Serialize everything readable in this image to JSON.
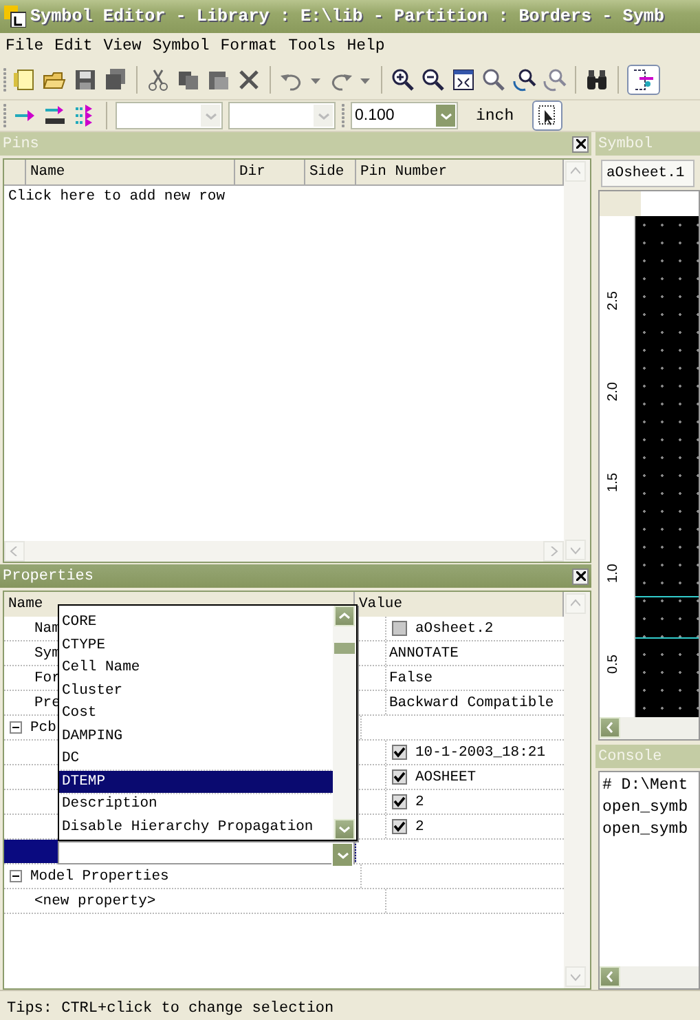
{
  "window": {
    "title": "Symbol Editor - Library : E:\\lib - Partition : Borders - Symb"
  },
  "menu": [
    "File",
    "Edit",
    "View",
    "Symbol",
    "Format",
    "Tools",
    "Help"
  ],
  "toolbar": {
    "pin_tool_pressed": true,
    "snap_value": "0.100",
    "unit": "inch",
    "select_tool_pressed": true
  },
  "pins": {
    "title": "Pins",
    "active": false,
    "columns": [
      "Name",
      "Dir",
      "Side",
      "Pin Number"
    ],
    "add_row_hint": "Click here to add new row"
  },
  "properties": {
    "title": "Properties",
    "active": true,
    "columns": [
      "Name",
      "Value"
    ],
    "rows": [
      {
        "kind": "prop",
        "name": "Nam",
        "value": "aOsheet.2",
        "checked": false
      },
      {
        "kind": "prop",
        "name": "Sym",
        "value": "ANNOTATE"
      },
      {
        "kind": "prop",
        "name": "For",
        "value": "False"
      },
      {
        "kind": "prop",
        "name": "Pre",
        "value": "Backward Compatible"
      },
      {
        "kind": "group",
        "name": "Pcb",
        "expanded": true
      },
      {
        "kind": "prop",
        "name": "",
        "value": "10-1-2003_18:21",
        "checked": true
      },
      {
        "kind": "prop",
        "name": "",
        "value": "AOSHEET",
        "checked": true
      },
      {
        "kind": "prop",
        "name": "",
        "value": "2",
        "checked": true
      },
      {
        "kind": "prop",
        "name": "",
        "value": "2",
        "checked": true
      },
      {
        "kind": "editing",
        "name": "",
        "value": ""
      },
      {
        "kind": "group",
        "name": "Model Properties",
        "expanded": true
      },
      {
        "kind": "new",
        "name": "<new property>"
      }
    ],
    "dropdown": [
      {
        "label": "CORE",
        "selected": false
      },
      {
        "label": "CTYPE",
        "selected": false
      },
      {
        "label": "Cell Name",
        "selected": false
      },
      {
        "label": "Cluster",
        "selected": false
      },
      {
        "label": "Cost",
        "selected": false
      },
      {
        "label": "DAMPING",
        "selected": false
      },
      {
        "label": "DC",
        "selected": false
      },
      {
        "label": "DTEMP",
        "selected": true
      },
      {
        "label": "Description",
        "selected": false
      },
      {
        "label": "Disable Hierarchy Propagation",
        "selected": false
      }
    ]
  },
  "symbol": {
    "title": "Symbol",
    "tab": "aOsheet.1",
    "ruler": [
      "2.5",
      "2.0",
      "1.5",
      "1.0",
      "0.5"
    ]
  },
  "console": {
    "title": "Console",
    "lines": [
      "# D:\\Ment",
      "open_symb",
      "open_symb"
    ]
  },
  "status_bar": {
    "tip": "Tips: CTRL+click to change selection"
  }
}
